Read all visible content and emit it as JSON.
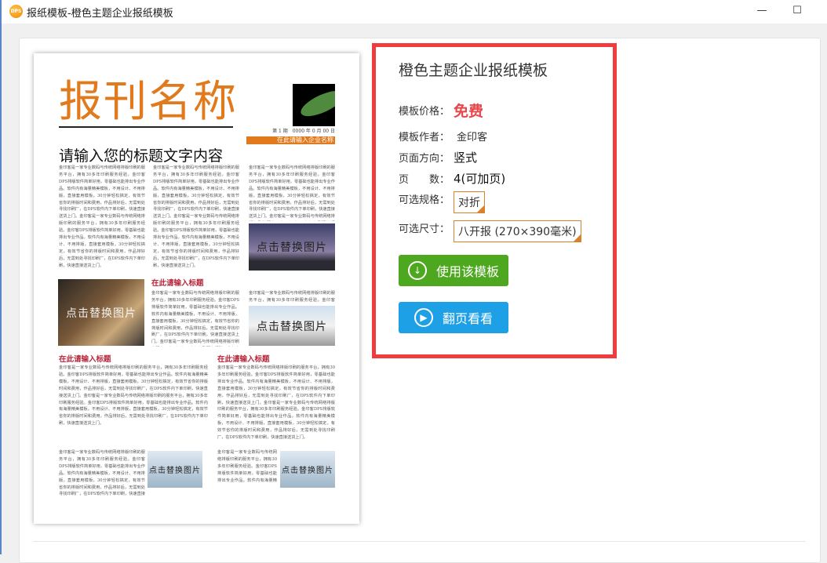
{
  "window": {
    "title": "报纸模板-橙色主题企业报纸模板",
    "logo_text": "DPS",
    "minimize": "—",
    "maximize": "☐"
  },
  "preview": {
    "masthead": "报刊名称",
    "issue": "第 1 期　0000 年 0 月 00 日",
    "company": "在此请输入企业名称",
    "headline": "请输入您的标题文字内容",
    "subtitle": "在此请输入标题",
    "image_placeholder": "点击替换图片",
    "body": "金印客是一家专业数码与传统网络排版印刷的服务平台，拥有30多年印刷服务经验。金印客DPS排版软件简单好用，零基础也能排出专业作品。软件内有海量精美模板，不用设计、不用排版，直接套用模板，30分钟轻松搞定，有效节省你的排版时间和费用，作品排好后，无需到处寻找印刷厂，在DPS软件内下单印刷，快速直接送货上门。金印客是一家专业数码与传统网络排版印刷的服务平台，拥有30多年印刷服务经验。金印客DPS排版软件简单好用，零基础也能排出专业作品。软件内有海量精美模板，不用设计、不用排版，直接套用模板，30分钟轻松搞定，有效节省你的排版时间和费用，作品排好后，无需到处寻找印刷厂，在DPS软件内下单印刷，快速直接送货上门。"
  },
  "info": {
    "title": "橙色主题企业报纸模板",
    "price_label": "模板价格：",
    "price": "免费",
    "author_label": "模板作者：",
    "author": "金印客",
    "orientation_label": "页面方向：",
    "orientation": "竖式",
    "pages_label": "页　　数：",
    "pages": "4(可加页)",
    "spec_label": "可选规格：",
    "spec": "对折",
    "size_label": "可选尺寸：",
    "size": "八开报 (270×390毫米)",
    "use_button": "使用该模板",
    "flip_button": "翻页看看"
  },
  "colors": {
    "accent_orange": "#e07a1c",
    "highlight_red": "#f03c3c",
    "green": "#4ea81f",
    "blue": "#1ea0e6"
  }
}
